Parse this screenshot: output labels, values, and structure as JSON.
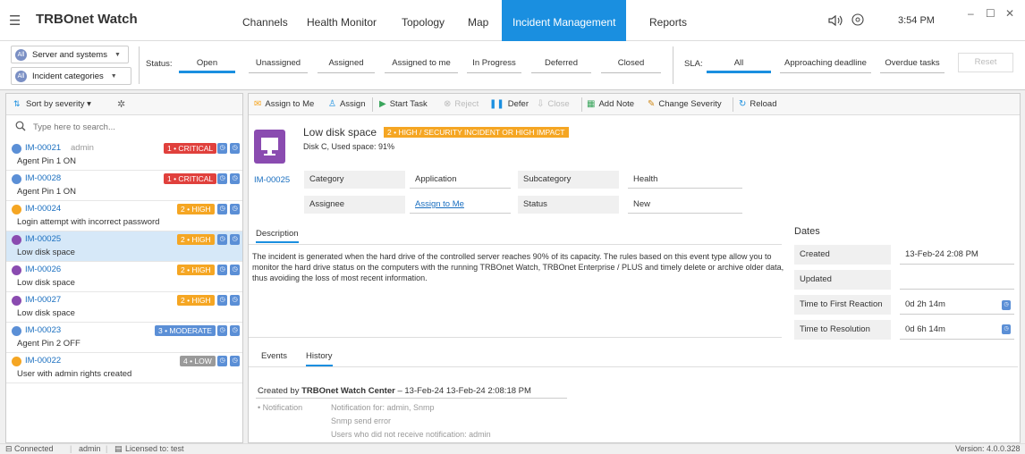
{
  "app": {
    "title": "TRBOnet Watch",
    "clock": "3:54 PM"
  },
  "nav": {
    "tabs": [
      "Channels",
      "Health Monitor",
      "Topology",
      "Map",
      "Incident Management",
      "Reports"
    ],
    "active": "Incident Management"
  },
  "filters": {
    "dropdown1": "Server and systems",
    "dropdown2": "Incident categories",
    "all_badge": "All",
    "status_label": "Status:",
    "status_tabs": [
      "Open",
      "Unassigned",
      "Assigned",
      "Assigned to me",
      "In Progress",
      "Deferred",
      "Closed"
    ],
    "sla_label": "SLA:",
    "sla_tabs": [
      "All",
      "Approaching deadline",
      "Overdue tasks"
    ],
    "reset": "Reset"
  },
  "list": {
    "sort_label": "Sort by severity",
    "search_placeholder": "Type here to search...",
    "items": [
      {
        "id": "IM-00021",
        "user": "admin",
        "title": "Agent Pin 1 ON",
        "severity": "1 • CRITICAL",
        "sev_color": "#e0403c",
        "icon_color": "#5b8fd6"
      },
      {
        "id": "IM-00028",
        "user": "",
        "title": "Agent Pin 1 ON",
        "severity": "1 • CRITICAL",
        "sev_color": "#e0403c",
        "icon_color": "#5b8fd6"
      },
      {
        "id": "IM-00024",
        "user": "",
        "title": "Login attempt with incorrect password",
        "severity": "2 • HIGH",
        "sev_color": "#f5a623",
        "icon_color": "#f5a623"
      },
      {
        "id": "IM-00025",
        "user": "",
        "title": "Low disk space",
        "severity": "2 • HIGH",
        "sev_color": "#f5a623",
        "icon_color": "#8a4bb0"
      },
      {
        "id": "IM-00026",
        "user": "",
        "title": "Low disk space",
        "severity": "2 • HIGH",
        "sev_color": "#f5a623",
        "icon_color": "#8a4bb0"
      },
      {
        "id": "IM-00027",
        "user": "",
        "title": "Low disk space",
        "severity": "2 • HIGH",
        "sev_color": "#f5a623",
        "icon_color": "#8a4bb0"
      },
      {
        "id": "IM-00023",
        "user": "",
        "title": "Agent Pin 2 OFF",
        "severity": "3 • MODERATE",
        "sev_color": "#5b8fd6",
        "icon_color": "#5b8fd6"
      },
      {
        "id": "IM-00022",
        "user": "",
        "title": "User with admin rights created",
        "severity": "4 • LOW",
        "sev_color": "#9a9a9a",
        "icon_color": "#f5a623"
      }
    ]
  },
  "toolbar": {
    "assign_to_me": "Assign to Me",
    "assign": "Assign",
    "start_task": "Start Task",
    "reject": "Reject",
    "defer": "Defer",
    "close": "Close",
    "add_note": "Add Note",
    "change_severity": "Change Severity",
    "reload": "Reload"
  },
  "detail": {
    "title": "Low disk space",
    "severity_banner": "2 • HIGH  / SECURITY INCIDENT OR HIGH IMPACT",
    "subtitle": "Disk C, Used space: 91%",
    "id": "IM-00025",
    "category_label": "Category",
    "category_value": "Application",
    "subcategory_label": "Subcategory",
    "subcategory_value": "Health",
    "assignee_label": "Assignee",
    "assignee_value": "Assign to Me",
    "status_label": "Status",
    "status_value": "New",
    "description_tab": "Description",
    "description": "The incident is generated when the hard drive of the controlled server reaches 90% of its capacity. The rules based on this event type allow you to monitor the hard drive status on the computers with the running TRBOnet Watch, TRBOnet Enterprise / PLUS and timely delete or archive older data, thus avoiding the loss of most recent information."
  },
  "dates": {
    "title": "Dates",
    "created_label": "Created",
    "created_value": "13-Feb-24 2:08 PM",
    "updated_label": "Updated",
    "updated_value": "",
    "first_reaction_label": "Time to First Reaction",
    "first_reaction_value": "0d 2h 14m",
    "resolution_label": "Time to Resolution",
    "resolution_value": "0d 6h 14m"
  },
  "history": {
    "events_tab": "Events",
    "history_tab": "History",
    "created_by_prefix": "Created by",
    "created_by": "TRBOnet Watch Center",
    "created_time": "–  13-Feb-24 13-Feb-24 2:08:18 PM",
    "notification_label": "• Notification",
    "notification_lines": [
      "Notification for: admin, Snmp",
      "Snmp send error",
      "Users who did not receive notification: admin"
    ]
  },
  "status": {
    "connected": "Connected",
    "user": "admin",
    "license": "Licensed to: test",
    "version": "Version: 4.0.0.328"
  },
  "colors": {
    "accent": "#1a8fe0",
    "critical": "#e0403c",
    "high": "#f5a623",
    "moderate": "#5b8fd6",
    "low": "#9a9a9a"
  }
}
